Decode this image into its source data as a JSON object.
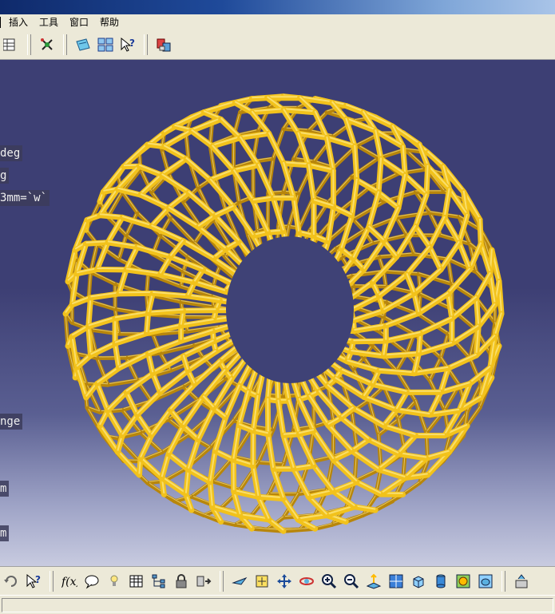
{
  "menu": {
    "items": [
      "插入",
      "工具",
      "窗口",
      "帮助"
    ]
  },
  "toolbar_top": {
    "icons": [
      "constraint-table-icon",
      "snap-tool-icon",
      "open-file-icon",
      "multi-window-icon",
      "whats-this-icon",
      "catalog-icon"
    ]
  },
  "viewport": {
    "params": [
      {
        "text": "deg"
      },
      {
        "text": "g"
      },
      {
        "text": "3mm=`w`"
      },
      {
        "text": "nge"
      },
      {
        "text": "m"
      },
      {
        "text": "m"
      }
    ],
    "model": {
      "name": "hexagonal-lattice-torus",
      "color": "#f2c21b"
    }
  },
  "toolbar_bottom": {
    "icons": [
      "undo-icon",
      "whats-this-icon",
      "formula-icon",
      "comment-icon",
      "light-icon",
      "table-icon",
      "tree-icon",
      "lock-icon",
      "hide-show-icon",
      "fly-mode-icon",
      "fit-all-icon",
      "pan-icon",
      "rotate-icon",
      "zoom-in-icon",
      "zoom-out-icon",
      "normal-view-icon",
      "multi-view-icon",
      "iso-view-icon",
      "shading-icon",
      "render-style-icon",
      "hide-icon",
      "swap-visible-icon"
    ]
  }
}
